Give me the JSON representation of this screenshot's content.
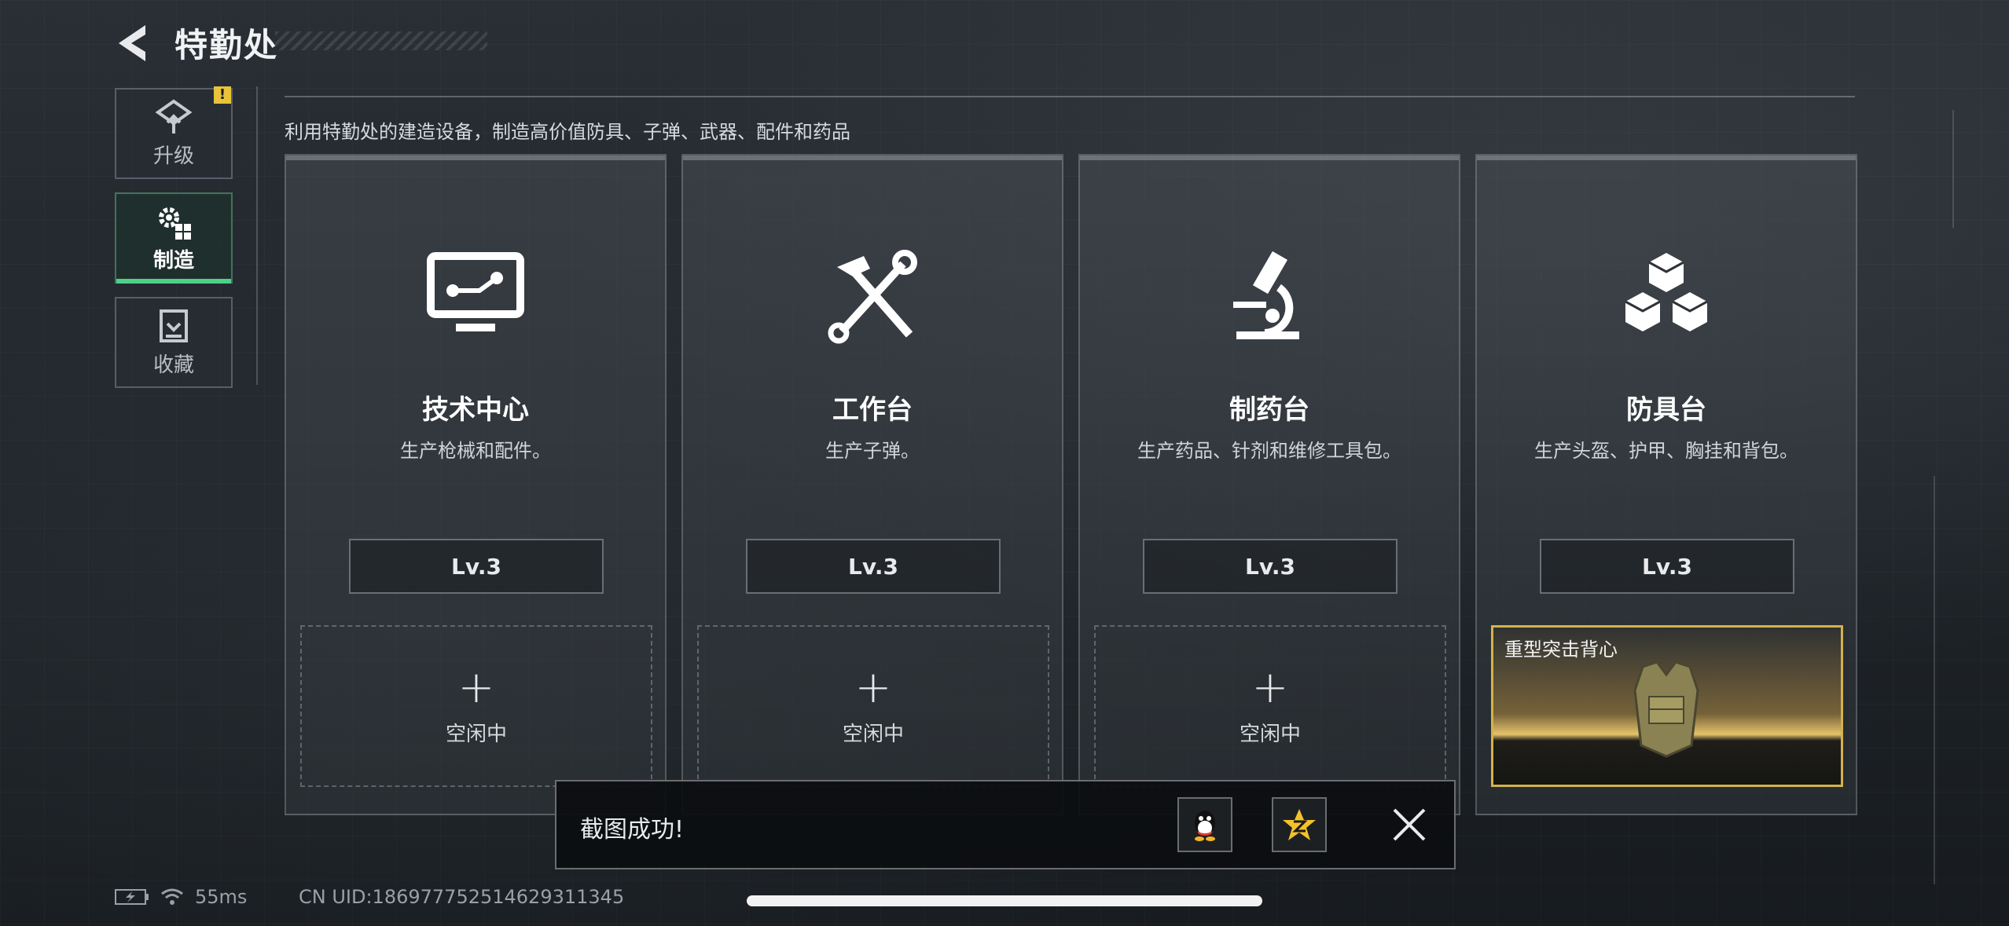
{
  "header": {
    "title": "特勤处"
  },
  "sidebar": {
    "items": [
      {
        "label": "升级",
        "icon": "upgrade-icon",
        "alert": "!"
      },
      {
        "label": "制造",
        "icon": "gear-icon",
        "active": true
      },
      {
        "label": "收藏",
        "icon": "collection-icon"
      }
    ]
  },
  "description": "利用特勤处的建造设备，制造高价值防具、子弹、武器、配件和药品",
  "cards": [
    {
      "name": "技术中心",
      "sub": "生产枪械和配件。",
      "level": "Lv.3",
      "icon": "monitor-icon",
      "slot": {
        "plus": "+",
        "status": "空闲中"
      }
    },
    {
      "name": "工作台",
      "sub": "生产子弹。",
      "level": "Lv.3",
      "icon": "hammer-wrench-icon",
      "slot": {
        "plus": "+",
        "status": "空闲中"
      }
    },
    {
      "name": "制药台",
      "sub": "生产药品、针剂和维修工具包。",
      "level": "Lv.3",
      "icon": "microscope-icon",
      "slot": {
        "plus": "+",
        "status": "空闲中"
      }
    },
    {
      "name": "防具台",
      "sub": "生产头盔、护甲、胸挂和背包。",
      "level": "Lv.3",
      "icon": "cubes-icon",
      "slot": {
        "item": "重型突击背心"
      }
    }
  ],
  "toast": {
    "message": "截图成功!",
    "share_icons": [
      "qq-icon",
      "qzone-icon"
    ],
    "close_icon": "close-icon"
  },
  "status": {
    "ping": "55ms",
    "uid": "CN UID:1869777525146293113​45"
  },
  "colors": {
    "accent_green": "#4fcf8a",
    "alert_yellow": "#e8c33a",
    "gold": "#d4b24c"
  }
}
